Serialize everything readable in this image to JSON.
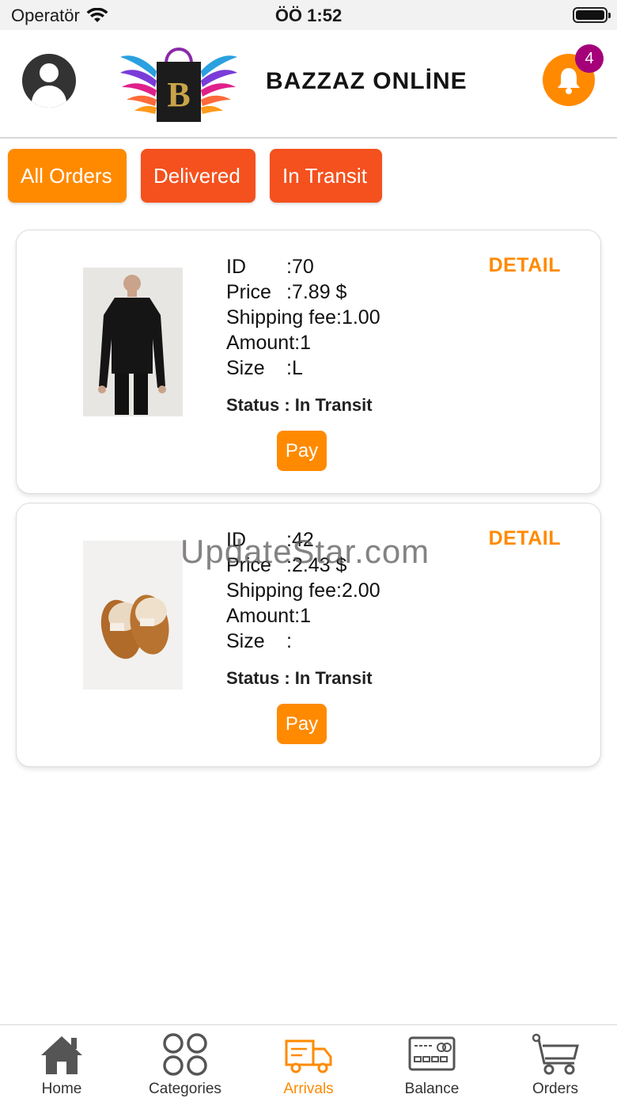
{
  "status_bar": {
    "carrier": "Operatör",
    "time": "ÖÖ 1:52"
  },
  "header": {
    "brand": "BAZZAZ ONLİNE",
    "notification_count": "4"
  },
  "tabs": [
    {
      "label": "All Orders"
    },
    {
      "label": "Delivered"
    },
    {
      "label": "In Transit"
    }
  ],
  "orders": [
    {
      "id_label": "ID",
      "id": ":70",
      "price_label": "Price",
      "price": ":7.89 $",
      "shipping_label": "Shipping fee",
      "shipping": ":1.00",
      "amount_label": "Amount",
      "amount": ":1",
      "size_label": "Size",
      "size": ":L",
      "status": "Status :  In Transit",
      "detail_label": "DETAIL",
      "pay_label": "Pay"
    },
    {
      "id_label": "ID",
      "id": ":42",
      "price_label": "Price",
      "price": ":2.43 $",
      "shipping_label": "Shipping fee",
      "shipping": ":2.00",
      "amount_label": "Amount",
      "amount": ":1",
      "size_label": "Size",
      "size": ":",
      "status": "Status :  In Transit",
      "detail_label": "DETAIL",
      "pay_label": "Pay"
    }
  ],
  "watermark": "UpdateStar.com",
  "bottom_nav": [
    {
      "label": "Home",
      "icon": "home-icon"
    },
    {
      "label": "Categories",
      "icon": "categories-icon"
    },
    {
      "label": "Arrivals",
      "icon": "truck-icon",
      "active": true
    },
    {
      "label": "Balance",
      "icon": "card-icon"
    },
    {
      "label": "Orders",
      "icon": "cart-icon"
    }
  ],
  "colors": {
    "accent": "#ff8a00",
    "tab_red": "#f4511e",
    "badge": "#a5007a"
  }
}
